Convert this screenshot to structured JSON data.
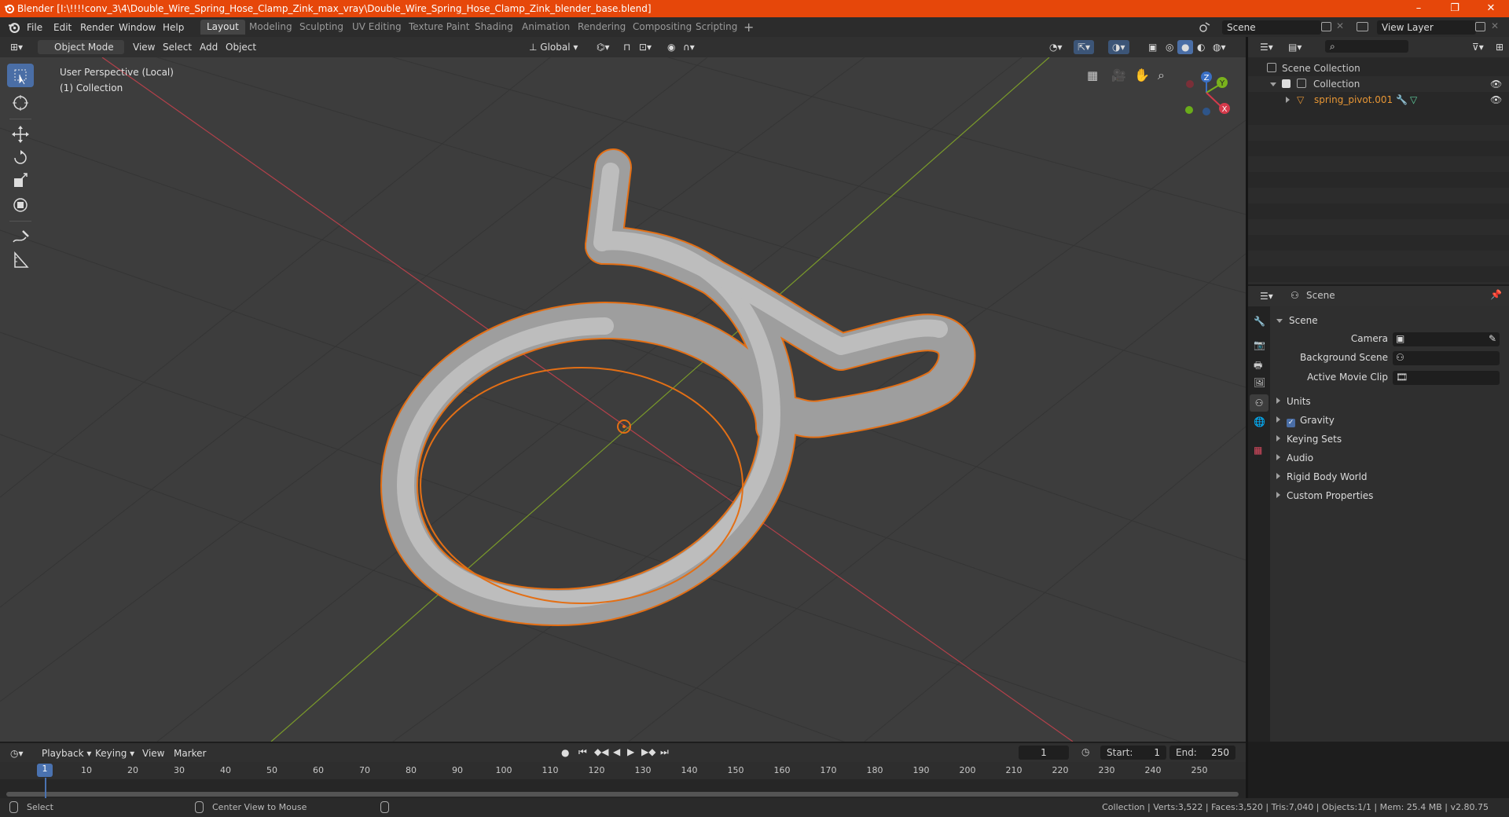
{
  "titlebar": {
    "title": "Blender [I:\\!!!!conv_3\\4\\Double_Wire_Spring_Hose_Clamp_Zink_max_vray\\Double_Wire_Spring_Hose_Clamp_Zink_blender_base.blend]",
    "minimize": "–",
    "maximize": "❐",
    "close": "✕"
  },
  "menu": [
    "File",
    "Edit",
    "Render",
    "Window",
    "Help"
  ],
  "workspaces": [
    "Layout",
    "Modeling",
    "Sculpting",
    "UV Editing",
    "Texture Paint",
    "Shading",
    "Animation",
    "Rendering",
    "Compositing",
    "Scripting"
  ],
  "workspace_add": "+",
  "scene_field": "Scene",
  "view_layer_field": "View Layer",
  "viewport_header": {
    "mode": "Object Mode",
    "view": "View",
    "select": "Select",
    "add": "Add",
    "object": "Object",
    "orientation": "Global"
  },
  "viewport": {
    "perspective": "User Perspective (Local)",
    "collection": "(1) Collection",
    "gizmo": {
      "x": "X",
      "y": "Y",
      "z": "Z"
    }
  },
  "outliner": {
    "scene_collection": "Scene Collection",
    "collection": "Collection",
    "object": "spring_pivot.001"
  },
  "properties": {
    "header": "Scene",
    "section": "Scene",
    "camera_label": "Camera",
    "background_scene_label": "Background Scene",
    "active_movie_clip_label": "Active Movie Clip",
    "subsections": [
      "Units",
      "Gravity",
      "Keying Sets",
      "Audio",
      "Rigid Body World",
      "Custom Properties"
    ]
  },
  "timeline": {
    "playback": "Playback",
    "keying": "Keying",
    "view": "View",
    "marker": "Marker",
    "current_frame": "1",
    "start_label": "Start:",
    "start_value": "1",
    "end_label": "End:",
    "end_value": "250",
    "ruler": [
      "1",
      "10",
      "20",
      "30",
      "40",
      "50",
      "60",
      "70",
      "80",
      "90",
      "100",
      "110",
      "120",
      "130",
      "140",
      "150",
      "160",
      "170",
      "180",
      "190",
      "200",
      "210",
      "220",
      "230",
      "240",
      "250"
    ]
  },
  "statusbar": {
    "select": "Select",
    "center_view": "Center View to Mouse",
    "stats": "Collection | Verts:3,522 | Faces:3,520 | Tris:7,040 | Objects:1/1 | Mem: 25.4 MB | v2.80.75"
  },
  "colors": {
    "accent": "#4a6ea6",
    "selection_outline": "#e36f15",
    "title_bar": "#e6470a",
    "x_axis": "#b3404a",
    "y_axis": "#7a9a2a"
  }
}
